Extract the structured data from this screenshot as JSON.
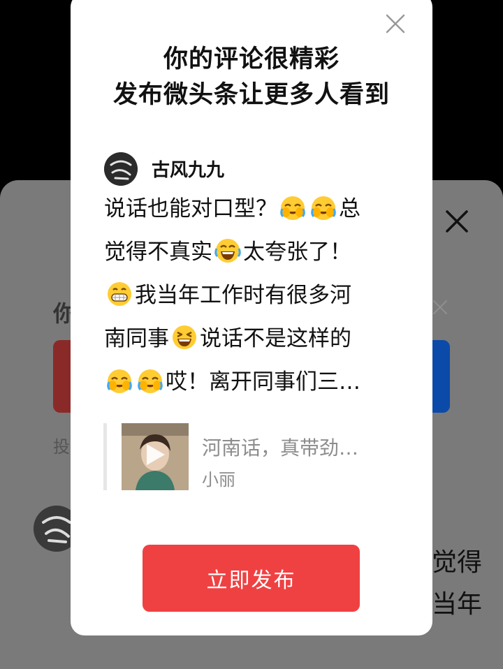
{
  "modal": {
    "title_line1": "你的评论很精彩",
    "title_line2": "发布微头条让更多人看到",
    "user_name": "古风九九",
    "comment": {
      "text1": "说话也能对口型？",
      "text2": "总",
      "text3": "觉得不真实",
      "text4": "太夸张了！",
      "text5": "我当年工作时有很多河",
      "text6": "南同事",
      "text7": "说话不是这样的",
      "text8": "哎！离开同事们三…"
    },
    "emoji_names": [
      "face-palm-laugh-icon",
      "face-palm-laugh-icon",
      "rolling-laughing-icon",
      "grinning-icon",
      "laughing-icon",
      "face-palm-laugh-icon",
      "face-palm-laugh-icon"
    ],
    "reference": {
      "title": "河南话，真带劲…",
      "author": "小丽"
    },
    "publish_label": "立即发布",
    "accent_color": "#f04142"
  },
  "background": {
    "title_partial": "你",
    "small_text_partial": "投",
    "text_partial_1": "觉得",
    "text_partial_2": "当年"
  }
}
